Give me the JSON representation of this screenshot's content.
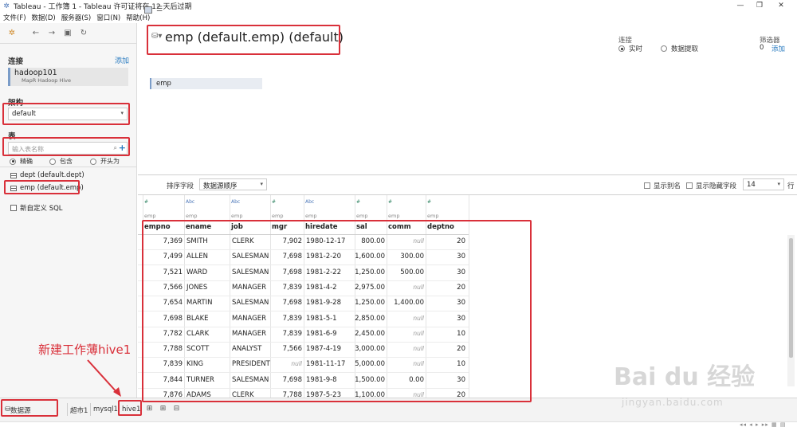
{
  "window": {
    "title": "Tableau - 工作簿 1 - Tableau 许可证将在 12 天后过期",
    "minimize": "—",
    "restore": "❐",
    "close": "✕"
  },
  "menu": [
    "文件(F)",
    "数据(D)",
    "服务器(S)",
    "窗口(N)",
    "帮助(H)"
  ],
  "sidebar": {
    "connections_label": "连接",
    "connections_add": "添加",
    "connection": {
      "name": "hadoop101",
      "type": "MapR Hadoop Hive"
    },
    "schema_label": "架构",
    "schema_value": "default",
    "table_label": "表",
    "table_search_placeholder": "输入表名称",
    "match_options": [
      "精确",
      "包含",
      "开头为"
    ],
    "tables": [
      "dept (default.dept)",
      "emp (default.emp)"
    ],
    "new_custom_sql": "新自定义 SQL"
  },
  "header": {
    "datasource_title": "emp (default.emp) (default)",
    "connection_label": "连接",
    "connection_modes": [
      "实时",
      "数据提取"
    ],
    "filters_label": "筛选器",
    "filters_count": "0",
    "filters_add": "添加",
    "canvas_table": "emp"
  },
  "grid_toolbar": {
    "sort_label": "排序字段",
    "sort_value": "数据源顺序",
    "show_aliases": "显示别名",
    "show_hidden": "显示隐藏字段",
    "rows_value": "14",
    "rows_label": "行"
  },
  "grid": {
    "columns": [
      {
        "name": "empno",
        "type": "#",
        "source": "emp"
      },
      {
        "name": "ename",
        "type": "Abc",
        "source": "emp"
      },
      {
        "name": "job",
        "type": "Abc",
        "source": "emp"
      },
      {
        "name": "mgr",
        "type": "#",
        "source": "emp"
      },
      {
        "name": "hiredate",
        "type": "Abc",
        "source": "emp"
      },
      {
        "name": "sal",
        "type": "#",
        "source": "emp"
      },
      {
        "name": "comm",
        "type": "#",
        "source": "emp"
      },
      {
        "name": "deptno",
        "type": "#",
        "source": "emp"
      }
    ],
    "rows": [
      [
        "7,369",
        "SMITH",
        "CLERK",
        "7,902",
        "1980-12-17",
        "800.00",
        "null",
        "20"
      ],
      [
        "7,499",
        "ALLEN",
        "SALESMAN",
        "7,698",
        "1981-2-20",
        "1,600.00",
        "300.00",
        "30"
      ],
      [
        "7,521",
        "WARD",
        "SALESMAN",
        "7,698",
        "1981-2-22",
        "1,250.00",
        "500.00",
        "30"
      ],
      [
        "7,566",
        "JONES",
        "MANAGER",
        "7,839",
        "1981-4-2",
        "2,975.00",
        "null",
        "20"
      ],
      [
        "7,654",
        "MARTIN",
        "SALESMAN",
        "7,698",
        "1981-9-28",
        "1,250.00",
        "1,400.00",
        "30"
      ],
      [
        "7,698",
        "BLAKE",
        "MANAGER",
        "7,839",
        "1981-5-1",
        "2,850.00",
        "null",
        "30"
      ],
      [
        "7,782",
        "CLARK",
        "MANAGER",
        "7,839",
        "1981-6-9",
        "2,450.00",
        "null",
        "10"
      ],
      [
        "7,788",
        "SCOTT",
        "ANALYST",
        "7,566",
        "1987-4-19",
        "3,000.00",
        "null",
        "20"
      ],
      [
        "7,839",
        "KING",
        "PRESIDENT",
        "null",
        "1981-11-17",
        "5,000.00",
        "null",
        "10"
      ],
      [
        "7,844",
        "TURNER",
        "SALESMAN",
        "7,698",
        "1981-9-8",
        "1,500.00",
        "0.00",
        "30"
      ],
      [
        "7,876",
        "ADAMS",
        "CLERK",
        "7,788",
        "1987-5-23",
        "1,100.00",
        "null",
        "20"
      ]
    ]
  },
  "tabs": {
    "datasource": "数据源",
    "sheets": [
      "超市1",
      "mysql1",
      "hive1"
    ]
  },
  "annotation": {
    "text": "新建工作薄hive1"
  },
  "watermark": {
    "main": "Bai du 经验",
    "sub": "jingyan.baidu.com"
  },
  "colors": {
    "annotation_red": "#d9303a",
    "link_blue": "#2a7bc0",
    "accent_blue": "#7a9cc8"
  }
}
